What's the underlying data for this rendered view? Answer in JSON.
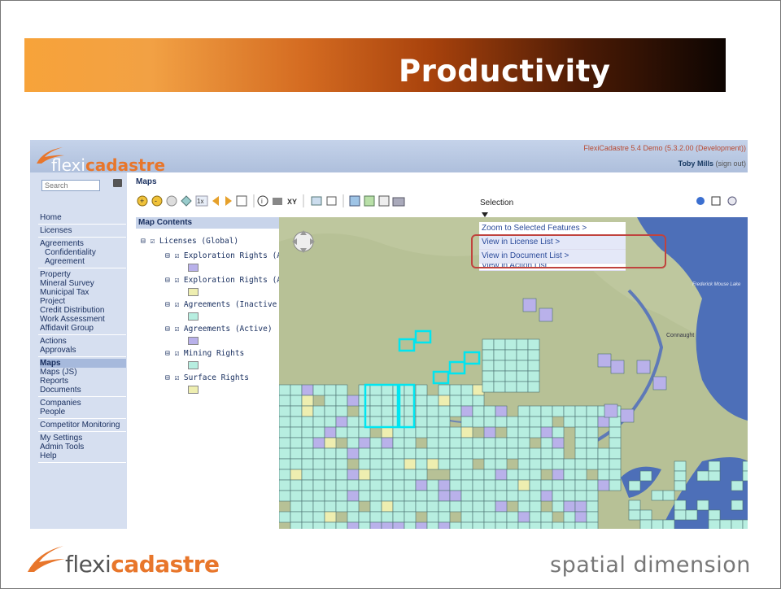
{
  "slide": {
    "title": "Productivity"
  },
  "app": {
    "logo": {
      "prefix": "flexi",
      "suffix": "cadastre"
    },
    "version": "FlexiCadastre 5.4 Demo (5.3.2.00 (Development))",
    "user": {
      "name": "Toby Mills",
      "sign_out": "(sign out)"
    },
    "search": {
      "placeholder": "Search"
    },
    "section_title": "Maps",
    "selection_label": "Selection",
    "nav_groups": [
      [
        "Home"
      ],
      [
        "Licenses"
      ],
      [
        "Agreements",
        "Confidentiality",
        "Agreement"
      ],
      [
        "Property",
        "Mineral Survey",
        "Municipal Tax",
        "Project",
        "Credit Distribution",
        "Work Assessment",
        "Affidavit Group"
      ],
      [
        "Actions",
        "Approvals"
      ],
      [
        "Maps",
        "Maps (JS)",
        "Reports",
        "Documents"
      ],
      [
        "Companies",
        "People"
      ],
      [
        "Competitor Monitoring"
      ],
      [
        "My Settings",
        "Admin Tools",
        "Help"
      ]
    ],
    "nav_active": "Maps",
    "toolbar": {
      "zoom_label": "1x",
      "xy_label": "XY"
    },
    "map_contents": {
      "title": "Map Contents",
      "root": "Licenses (Global)",
      "layers": [
        {
          "name": "Exploration Rights (A",
          "swatch": "#b9b1ea"
        },
        {
          "name": "Exploration Rights (A",
          "swatch": "#eeeeb0"
        },
        {
          "name": "Agreements (Inactive",
          "swatch": "#b7eee0"
        },
        {
          "name": "Agreements (Active)",
          "swatch": "#b9b1ea"
        },
        {
          "name": "Mining Rights",
          "swatch": "#b7eee0"
        },
        {
          "name": "Surface Rights",
          "swatch": "#eeeeb0"
        }
      ]
    },
    "context_menu": [
      "Zoom to Selected Features >",
      "View in License List >",
      "View in Document List >",
      "View in Action List"
    ],
    "map_labels": {
      "lake": "Frederick Mouse Lake",
      "town": "Connaught"
    }
  },
  "footer": {
    "logo_prefix": "flexi",
    "logo_suffix": "cadastre",
    "company": "spatial dimension"
  },
  "colors": {
    "accent": "#e8762b",
    "selection_outline": "#00e5f0",
    "highlight_box": "#c0433e",
    "parcel_green": "#b7eee0",
    "parcel_purple": "#b9b1ea"
  }
}
